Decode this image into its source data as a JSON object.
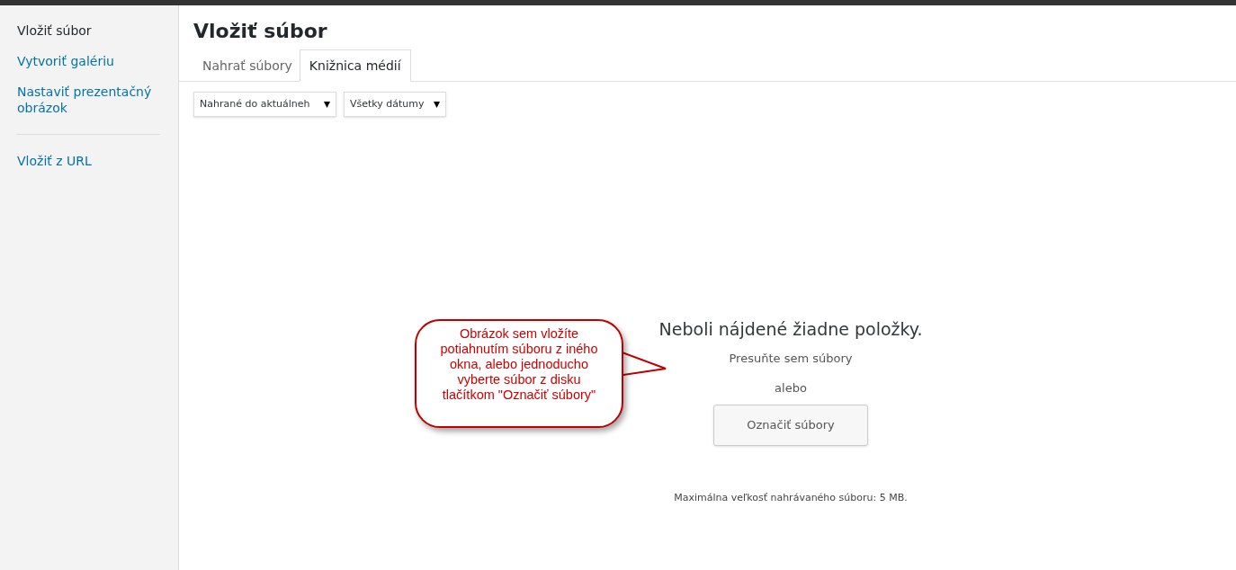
{
  "sidebar": {
    "items": [
      {
        "label": "Vložiť súbor",
        "selected": true
      },
      {
        "label": "Vytvoriť galériu",
        "selected": false
      },
      {
        "label": "Nastaviť prezentačný obrázok",
        "selected": false
      },
      {
        "label": "Vložiť z URL",
        "selected": false
      }
    ]
  },
  "title": "Vložiť súbor",
  "tabs": [
    {
      "label": "Nahrať súbory",
      "selected": false
    },
    {
      "label": "Knižnica médií",
      "selected": true
    }
  ],
  "filters": [
    {
      "value": "Nahrané do aktuálneh"
    },
    {
      "value": "Všetky dátumy"
    }
  ],
  "empty": {
    "heading": "Neboli nájdené žiadne položky.",
    "hint": "Presuňte sem súbory",
    "or": "alebo",
    "button": "Označiť súbory",
    "max_size": "Maximálna veľkosť nahrávaného súboru: 5 MB."
  },
  "callout": {
    "text": "Obrázok sem vložíte potiahnutím súboru z iného okna, alebo jednoducho vyberte súbor z disku tlačítkom \"Označiť súbory\""
  }
}
